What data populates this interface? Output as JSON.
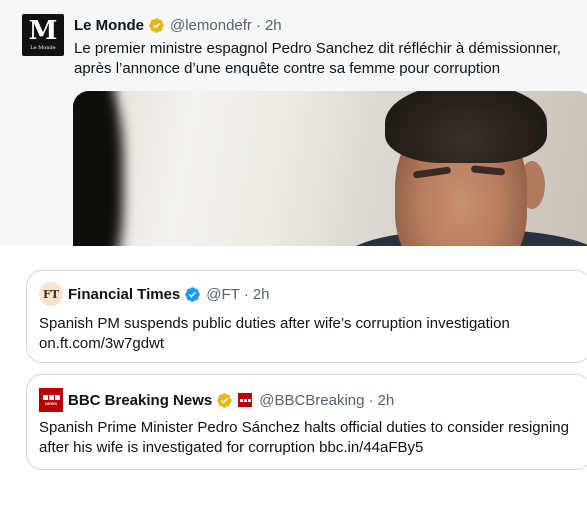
{
  "le_monde": {
    "name": "Le Monde",
    "handle": "@lemondefr",
    "separator": "·",
    "time": "2h",
    "avatar_letter": "M",
    "avatar_caption": "Le Monde",
    "text": "Le premier ministre espagnol Pedro Sanchez dit réfléchir à démissionner, après l’annonce d’une enquête contre sa femme pour corruption"
  },
  "ft": {
    "name": "Financial Times",
    "handle": "@FT",
    "separator": "·",
    "time": "2h",
    "avatar_text": "FT",
    "text": "Spanish PM suspends public duties after wife’s corruption investigation on.ft.com/3w7gdwt"
  },
  "bbc": {
    "name": "BBC Breaking News",
    "handle": "@BBCBreaking",
    "separator": "·",
    "time": "2h",
    "avatar_text": "NEWS",
    "text": "Spanish Prime Minister Pedro Sánchez halts official duties to consider resigning after his wife is investigated for corruption bbc.in/44aFBy5"
  },
  "colors": {
    "verified_gold": "#e2b719",
    "verified_blue": "#1d9bf0",
    "bbc_red": "#b80000",
    "text_secondary": "#536471",
    "card_border": "#cfd9de"
  }
}
